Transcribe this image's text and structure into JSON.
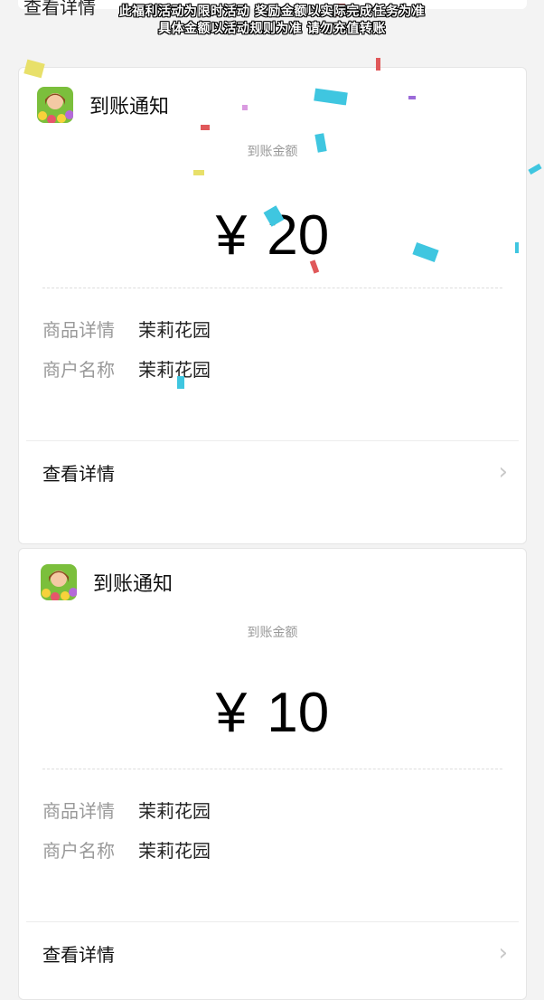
{
  "top_banner": {
    "line1": "此福利活动为限时活动 奖励金额以实际完成任务为准",
    "line2": "具体金额以活动规则为准 请勿充值转账"
  },
  "top_card_partial": {
    "label": "查看详情"
  },
  "notifications": [
    {
      "title": "到账通知",
      "amount_label": "到账金额",
      "currency": "¥",
      "amount": "20",
      "goods_key": "商品详情",
      "goods_value": "茉莉花园",
      "merchant_key": "商户名称",
      "merchant_value": "茉莉花园",
      "detail_label": "查看详情"
    },
    {
      "title": "到账通知",
      "amount_label": "到账金额",
      "currency": "¥",
      "amount": "10",
      "goods_key": "商品详情",
      "goods_value": "茉莉花园",
      "merchant_key": "商户名称",
      "merchant_value": "茉莉花园",
      "detail_label": "查看详情"
    }
  ],
  "icons": {
    "app": "garden-girl-app-icon",
    "chevron": "chevron-right-icon"
  }
}
